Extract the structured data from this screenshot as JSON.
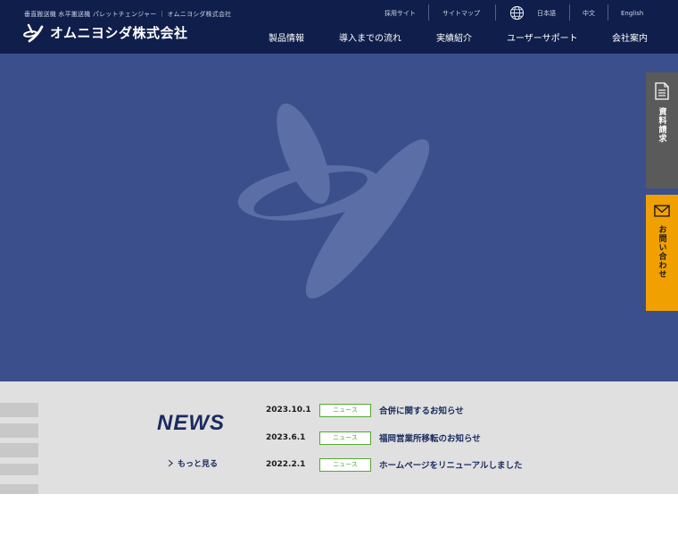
{
  "header": {
    "tagline": "垂直搬送機 水平搬送機 パレットチェンジャー ｜ オムニヨシダ株式会社",
    "logo_text": "オムニヨシダ株式会社",
    "utility": {
      "recruit": "採用サイト",
      "sitemap": "サイトマップ",
      "lang_ja": "日本語",
      "lang_zh": "中文",
      "lang_en": "English"
    },
    "nav": [
      {
        "label": "製品情報"
      },
      {
        "label": "導入までの流れ"
      },
      {
        "label": "実績紹介"
      },
      {
        "label": "ユーザーサポート"
      },
      {
        "label": "会社案内"
      }
    ]
  },
  "side_tabs": {
    "docs_label": "資料請求",
    "contact_label": "お問い合わせ"
  },
  "news": {
    "title": "NEWS",
    "more_label": "もっと見る",
    "items": [
      {
        "date": "2023.10.1",
        "tag": "ニュース",
        "text": "合併に関するお知らせ"
      },
      {
        "date": "2023.6.1",
        "tag": "ニュース",
        "text": "福岡営業所移転のお知らせ"
      },
      {
        "date": "2022.2.1",
        "tag": "ニュース",
        "text": "ホームページをリニューアルしました"
      }
    ]
  },
  "colors": {
    "header_bg": "#0f1e4a",
    "hero_bg": "#3a4f8c",
    "tab_docs": "#5a5a5a",
    "tab_contact": "#f0a000",
    "news_tag": "#55a833"
  }
}
